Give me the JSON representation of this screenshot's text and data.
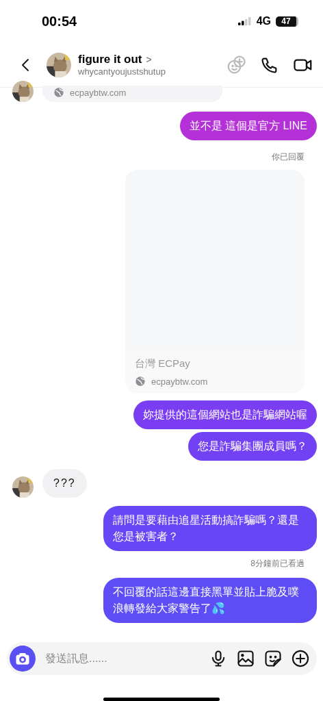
{
  "status_bar": {
    "time": "00:54",
    "network": "4G",
    "battery": "47"
  },
  "header": {
    "name": "figure it out",
    "chevron": ">",
    "username": "whycantyoujustshutup"
  },
  "messages": [
    {
      "kind": "link_tail",
      "outgoing": false,
      "url": "ecpaybtw.com"
    },
    {
      "kind": "text",
      "outgoing": true,
      "text": "並不是 這個是官方 LINE",
      "color": "#b431d8"
    },
    {
      "kind": "note",
      "text": "你已回覆"
    },
    {
      "kind": "link",
      "outgoing": true,
      "title": "台灣 ECPay",
      "url": "ecpaybtw.com"
    },
    {
      "kind": "text",
      "outgoing": true,
      "text": "妳提供的這個網站也是詐騙網站喔",
      "color": "#7b3df2"
    },
    {
      "kind": "text",
      "outgoing": true,
      "text": "您是詐騙集團成員嗎？",
      "color": "#7341f4"
    },
    {
      "kind": "text",
      "outgoing": false,
      "text": "???"
    },
    {
      "kind": "text",
      "outgoing": true,
      "text": "請問是要藉由追星活動搞詐騙嗎？還是您是被害者？",
      "color": "#6646f5"
    },
    {
      "kind": "note",
      "text": "8分鐘前已看過"
    },
    {
      "kind": "text",
      "outgoing": true,
      "text": "不回覆的話這邊直接黑單並貼上脆及噗浪轉發給大家警告了💦",
      "color": "#5e4cf5"
    }
  ],
  "composer": {
    "placeholder": "發送訊息......"
  }
}
